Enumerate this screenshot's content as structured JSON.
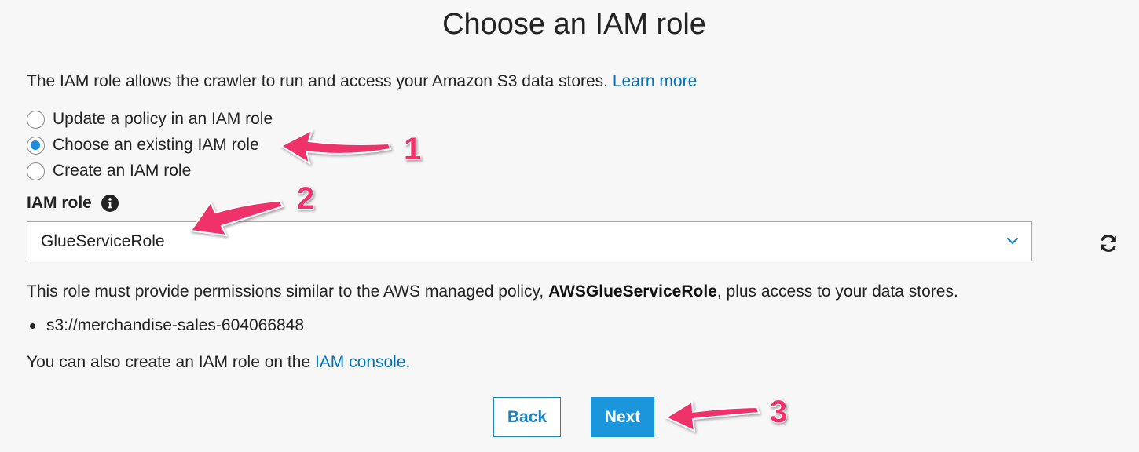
{
  "page": {
    "title": "Choose an IAM role",
    "intro_text": "The IAM role allows the crawler to run and access your Amazon S3 data stores.",
    "learn_more": "Learn more"
  },
  "options": [
    {
      "label": "Update a policy in an IAM role",
      "checked": false
    },
    {
      "label": "Choose an existing IAM role",
      "checked": true
    },
    {
      "label": "Create an IAM role",
      "checked": false
    }
  ],
  "iam_field": {
    "label": "IAM role",
    "selected": "GlueServiceRole"
  },
  "description": {
    "before": "This role must provide permissions similar to the AWS managed policy,",
    "policy": "AWSGlueServiceRole",
    "after": ", plus access to your data stores."
  },
  "data_stores": [
    "s3://merchandise-sales-604066848"
  ],
  "footer_note": {
    "text": "You can also create an IAM role on the",
    "link": "IAM console."
  },
  "buttons": {
    "back": "Back",
    "next": "Next"
  },
  "annotations": [
    "1",
    "2",
    "3"
  ],
  "colors": {
    "link": "#0073bb",
    "primary": "#1b96dc",
    "arrow": "#f0306a"
  },
  "icons": [
    "info-icon",
    "chevron-down-icon",
    "refresh-icon"
  ]
}
